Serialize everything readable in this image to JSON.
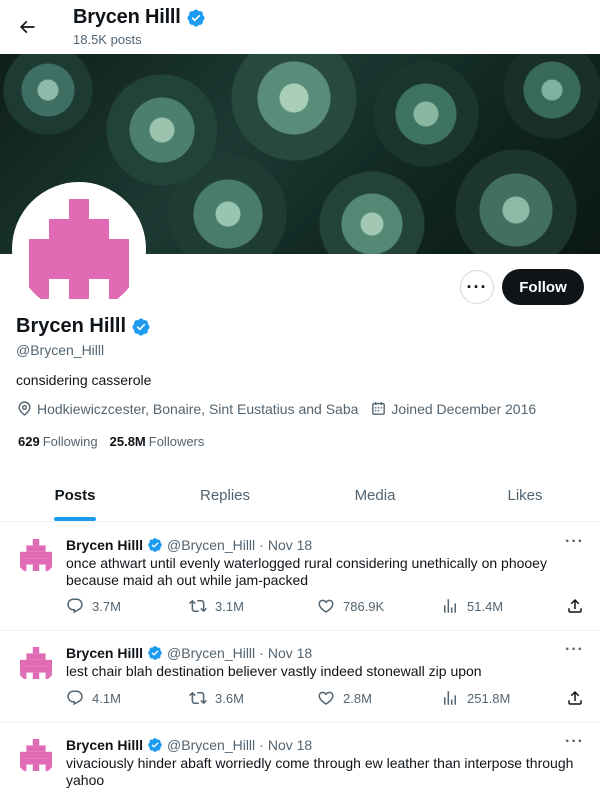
{
  "header": {
    "name": "Brycen Hilll",
    "posts_count": "18.5K posts"
  },
  "profile": {
    "name": "Brycen Hilll",
    "handle": "@Brycen_Hilll",
    "bio": "considering casserole",
    "location": "Hodkiewiczcester, Bonaire, Sint Eustatius and Saba",
    "joined": "Joined December 2016",
    "following_count": "629",
    "following_label": "Following",
    "followers_count": "25.8M",
    "followers_label": "Followers",
    "follow_label": "Follow",
    "more_label": "···"
  },
  "tabs": [
    {
      "label": "Posts",
      "active": true
    },
    {
      "label": "Replies",
      "active": false
    },
    {
      "label": "Media",
      "active": false
    },
    {
      "label": "Likes",
      "active": false
    }
  ],
  "tweets": [
    {
      "name": "Brycen Hilll",
      "handle": "@Brycen_Hilll",
      "sep": "·",
      "date": "Nov 18",
      "text": "once athwart until evenly waterlogged rural considering unethically on phooey because maid ah out while jam-packed",
      "replies": "3.7M",
      "reposts": "3.1M",
      "likes": "786.9K",
      "views": "51.4M"
    },
    {
      "name": "Brycen Hilll",
      "handle": "@Brycen_Hilll",
      "sep": "·",
      "date": "Nov 18",
      "text": "lest chair blah destination believer vastly indeed stonewall zip upon",
      "replies": "4.1M",
      "reposts": "3.6M",
      "likes": "2.8M",
      "views": "251.8M"
    },
    {
      "name": "Brycen Hilll",
      "handle": "@Brycen_Hilll",
      "sep": "·",
      "date": "Nov 18",
      "text": "vivaciously hinder abaft worriedly come through ew leather than interpose through yahoo",
      "replies": "",
      "reposts": "",
      "likes": "",
      "views": ""
    }
  ],
  "colors": {
    "accent": "#1d9bf0",
    "verified": "#1d9bf0",
    "avatar_pink": "#e06ab4",
    "text_primary": "#0f1419",
    "text_secondary": "#536471"
  },
  "icons": {
    "back": "arrow-left-icon",
    "verified": "verified-badge-icon",
    "location": "location-pin-icon",
    "calendar": "calendar-icon",
    "reply": "reply-icon",
    "repost": "repost-icon",
    "like": "heart-icon",
    "views": "views-chart-icon",
    "share": "share-icon",
    "more": "more-dots-icon"
  }
}
